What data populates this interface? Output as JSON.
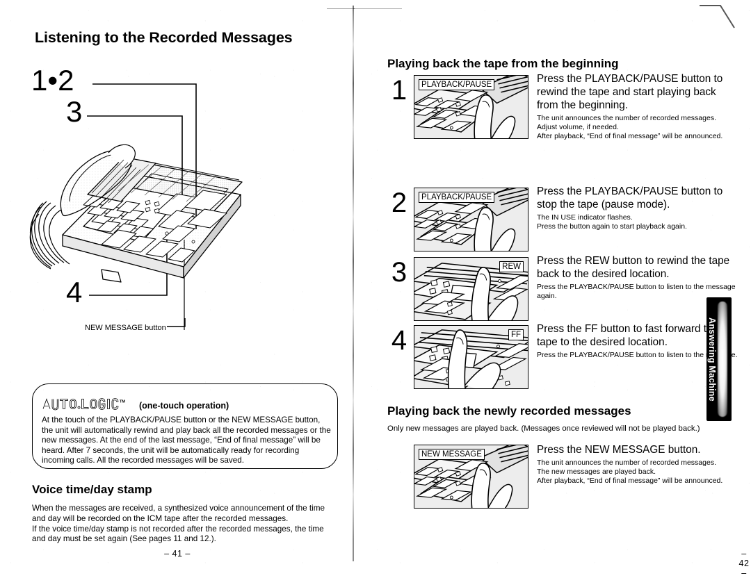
{
  "document": {
    "type": "scanned-manual-spread",
    "left_page_number": "– 41 –",
    "right_page_number": "– 42 –"
  },
  "side_tab": {
    "label": "Answering Machine"
  },
  "left_page": {
    "title": "Listening to the Recorded Messages",
    "callouts": [
      {
        "id": "callout-12",
        "text": "1•2"
      },
      {
        "id": "callout-3",
        "text": "3"
      },
      {
        "id": "callout-4",
        "text": "4"
      }
    ],
    "illustration_caption": "NEW MESSAGE button",
    "autologic": {
      "logo_text": "AUTO·LOGIC",
      "trademark": "TM",
      "subtitle": "(one-touch operation)",
      "body": "At the touch of the PLAYBACK/PAUSE button or the NEW MESSAGE button, the unit will automatically rewind and play back all the recorded messages or the new messages. At the end of the last message, “End of final message” will be heard. After 7 seconds, the unit will be automatically ready for recording incoming calls. All the recorded messages will be saved."
    },
    "voice_stamp": {
      "heading": "Voice time/day stamp",
      "body": "When the messages are received, a synthesized voice announcement of the time and day will be recorded on the ICM tape after the recorded messages.\nIf the voice time/day stamp is not recorded after the recorded messages, the time and day must be set again (See pages 11 and 12.)."
    }
  },
  "right_page": {
    "section_1": {
      "heading": "Playing back the tape from the beginning",
      "steps": [
        {
          "number": "1",
          "photo_label": "PLAYBACK/PAUSE",
          "main": "Press the PLAYBACK/PAUSE button to rewind the tape and start playing back from the beginning.",
          "sub": "The unit announces the number of recorded messages.\nAdjust volume, if needed.\nAfter playback, “End of final message” will be announced."
        },
        {
          "number": "2",
          "photo_label": "PLAYBACK/PAUSE",
          "main": "Press the PLAYBACK/PAUSE button to stop the tape (pause mode).",
          "sub": "The IN USE indicator flashes.\nPress the button again to start playback again."
        },
        {
          "number": "3",
          "photo_label": "REW",
          "main": "Press the REW button to rewind the tape back to the desired location.",
          "sub": "Press the PLAYBACK/PAUSE button to listen to the message again."
        },
        {
          "number": "4",
          "photo_label": "FF",
          "main": "Press the FF button to fast forward the tape to the desired location.",
          "sub": "Press the PLAYBACK/PAUSE button to listen to the message."
        }
      ]
    },
    "section_2": {
      "heading": "Playing back the newly recorded messages",
      "note": "Only new messages are played back. (Messages once reviewed will not be played back.)",
      "step": {
        "photo_label": "NEW MESSAGE",
        "main": "Press the NEW MESSAGE button.",
        "sub": "The unit announces the number of recorded messages.\nThe new messages are played back.\nAfter playback, “End of final message” will be announced."
      }
    }
  }
}
